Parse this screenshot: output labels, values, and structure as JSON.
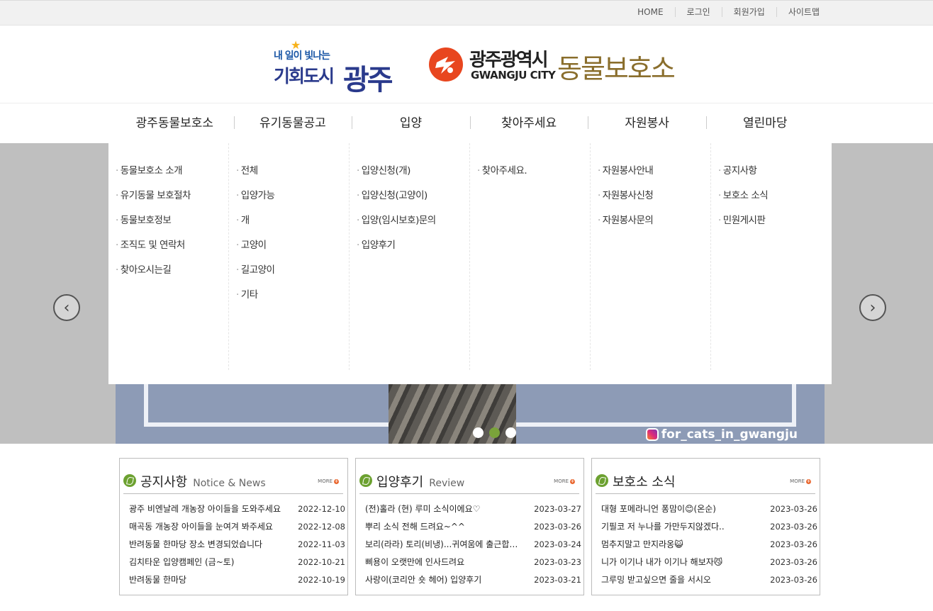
{
  "topbar": {
    "links": [
      "HOME",
      "로그인",
      "회원가입",
      "사이트맵"
    ]
  },
  "logos": {
    "city_slogan": "내 일이 빛나는",
    "city_name": "기회도시",
    "city_big": "광주",
    "shelter_ko": "광주광역시",
    "shelter_en": "GWANGJU CITY",
    "shelter_name": "동물보호소"
  },
  "nav": {
    "items": [
      "광주동물보호소",
      "유기동물공고",
      "입양",
      "찾아주세요",
      "자원봉사",
      "열린마당"
    ]
  },
  "mega_menu": {
    "columns": [
      [
        "동물보호소 소개",
        "유기동물 보호절차",
        "동물보호정보",
        "조직도 및 연락처",
        "찾아오시는길"
      ],
      [
        "전체",
        "입양가능",
        "개",
        "고양이",
        "길고양이",
        "기타"
      ],
      [
        "입양신청(개)",
        "입양신청(고양이)",
        "입양(임시보호)문의",
        "입양후기"
      ],
      [
        "찾아주세요."
      ],
      [
        "자원봉사안내",
        "자원봉사신청",
        "자원봉사문의"
      ],
      [
        "공지사항",
        "보호소 소식",
        "민원게시판"
      ]
    ]
  },
  "hero": {
    "instagram": "for_cats_in_gwangju",
    "prev_icon": "chevron-left-icon",
    "next_icon": "chevron-right-icon",
    "prev_glyph": "‹",
    "next_glyph": "›",
    "active_dot": 1,
    "dot_count": 3
  },
  "boards": [
    {
      "title": "공지사항",
      "subtitle": "Notice & News",
      "more": "MORE",
      "items": [
        {
          "text": "광주 비엔날레 개농장 아이들을 도와주세요",
          "date": "2022-12-10"
        },
        {
          "text": "매곡동 개농장 아이들을 눈여겨 봐주세요",
          "date": "2022-12-08"
        },
        {
          "text": "반려동물 한마당 장소 변경되었습니다",
          "date": "2022-11-03"
        },
        {
          "text": "김치타운 입양캠페인 (금~토)",
          "date": "2022-10-21"
        },
        {
          "text": "반려동물 한마당",
          "date": "2022-10-19"
        }
      ]
    },
    {
      "title": "입양후기",
      "subtitle": "Review",
      "more": "MORE",
      "items": [
        {
          "text": "(전)홀라 (현) 루미 소식이에요♡",
          "date": "2023-03-27"
        },
        {
          "text": "뿌리 소식 전해 드려요~^^",
          "date": "2023-03-26"
        },
        {
          "text": "보리(라라) 토리(비냉)...귀여움에 출근합니다",
          "date": "2023-03-24"
        },
        {
          "text": "삐용이 오랫만에 인사드려요",
          "date": "2023-03-23"
        },
        {
          "text": "사랑이(코리안 숏 헤어) 입양후기",
          "date": "2023-03-21"
        }
      ]
    },
    {
      "title": "보호소 소식",
      "subtitle": "",
      "more": "MORE",
      "items": [
        {
          "text": "대형 포메라니언 퐁맘이😊(온순)",
          "date": "2023-03-26"
        },
        {
          "text": "기필코 저 누나를 가만두지않겠다..",
          "date": "2023-03-26"
        },
        {
          "text": "멈추지말고 만지라옹😺",
          "date": "2023-03-26"
        },
        {
          "text": "니가 이기나 내가 이기나 해보자😼",
          "date": "2023-03-26"
        },
        {
          "text": "그루밍 받고싶으면 줄을 서시오",
          "date": "2023-03-26"
        }
      ]
    }
  ],
  "colors": {
    "accent_green": "#6ca130",
    "shelter_gold": "#8a6e2c",
    "city_blue": "#2a3a8c",
    "emblem_red": "#e8461f"
  }
}
